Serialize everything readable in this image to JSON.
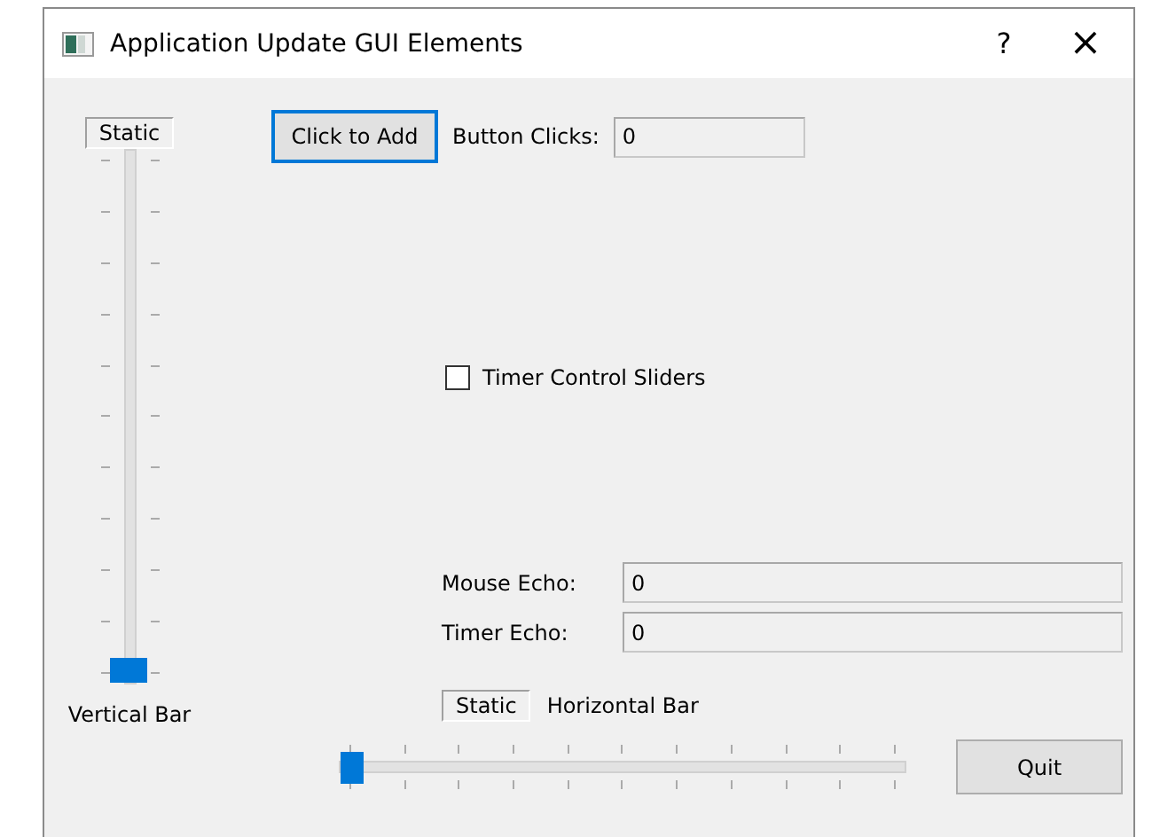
{
  "window": {
    "title": "Application Update GUI Elements",
    "help": "?",
    "close": "×"
  },
  "vertical": {
    "static": "Static",
    "label": "Vertical Bar",
    "level": 0
  },
  "add_button": "Click to Add",
  "clicks": {
    "label": "Button Clicks:",
    "value": "0"
  },
  "timer_checkbox": {
    "label": "Timer Control Sliders",
    "checked": false
  },
  "mouse_echo": {
    "label": "Mouse Echo:",
    "value": "0"
  },
  "timer_echo": {
    "label": "Timer Echo:",
    "value": "0"
  },
  "horizontal": {
    "static": "Static",
    "label": "Horizontal Bar",
    "level": 0
  },
  "quit_button": "Quit"
}
